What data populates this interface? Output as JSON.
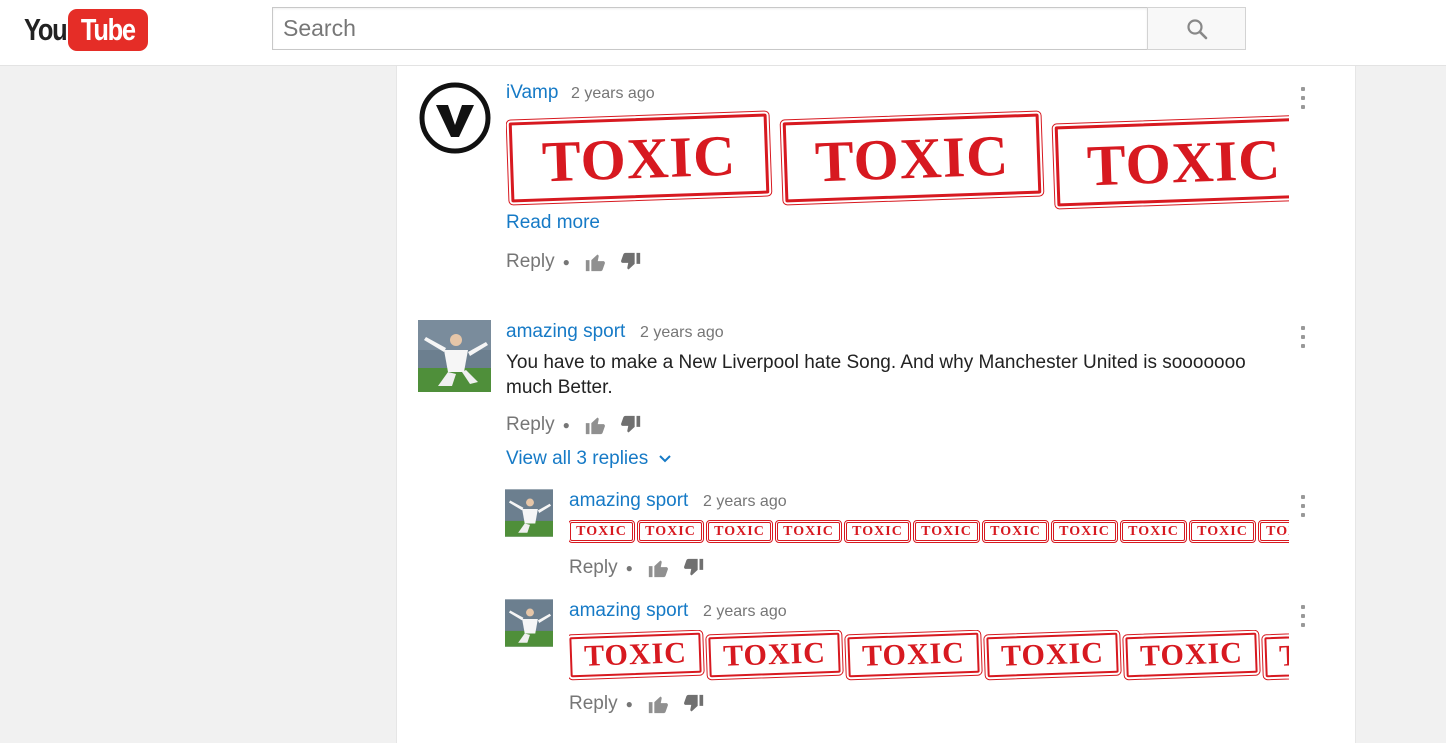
{
  "header": {
    "logo_you": "You",
    "logo_tube": "Tube",
    "search_placeholder": "Search"
  },
  "comments": [
    {
      "author": "iVamp",
      "time": "2 years ago",
      "stamp_text": "TOXIC",
      "read_more": "Read more",
      "reply_label": "Reply"
    },
    {
      "author": "amazing sport",
      "time": "2 years ago",
      "text": "You have to make a New Liverpool hate Song. And why Manchester United is sooooooo much Better.",
      "reply_label": "Reply",
      "view_replies": "View all 3 replies"
    }
  ],
  "replies": [
    {
      "author": "amazing sport",
      "time": "2 years ago",
      "stamp_text": "TOXIC",
      "reply_label": "Reply"
    },
    {
      "author": "amazing sport",
      "time": "2 years ago",
      "stamp_text": "TOXIC",
      "reply_label": "Reply"
    }
  ],
  "colors": {
    "link": "#167ac6",
    "stamp_red": "#d71920",
    "logo_red": "#e52d27"
  }
}
